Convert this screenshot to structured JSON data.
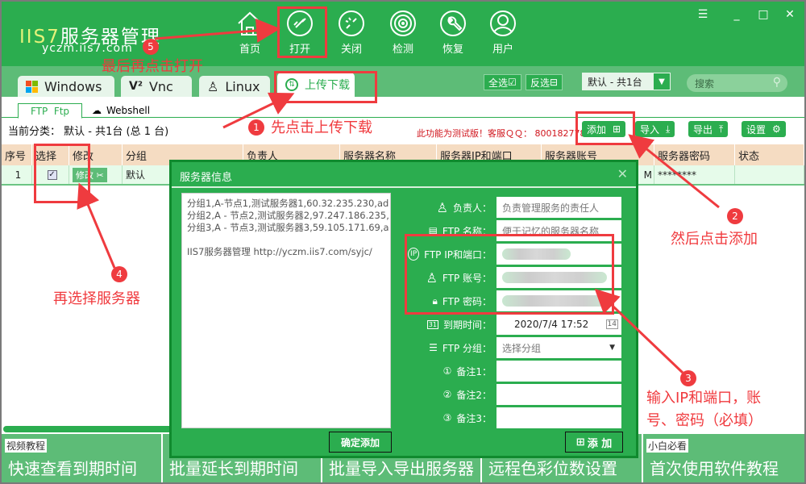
{
  "app": {
    "title_a": "IIS7",
    "title_b": "服务器管理",
    "subtitle": "yczm.iis7.com"
  },
  "nav": [
    {
      "label": "首页",
      "icon": "home-icon"
    },
    {
      "label": "打开",
      "icon": "link-icon"
    },
    {
      "label": "关闭",
      "icon": "unlink-icon"
    },
    {
      "label": "检测",
      "icon": "radar-icon"
    },
    {
      "label": "恢复",
      "icon": "wrench-icon"
    },
    {
      "label": "用户",
      "icon": "user-icon"
    }
  ],
  "window_controls": {
    "menu": "☰",
    "minimize": "_",
    "maximize": "□",
    "close": "✕"
  },
  "tabs": [
    {
      "label": "Windows",
      "icon": "windows-icon"
    },
    {
      "label": "Vnc",
      "icon": "vnc-icon"
    },
    {
      "label": "Linux",
      "icon": "linux-icon"
    },
    {
      "label": "上传下载",
      "icon": "upload-download-icon",
      "active": true
    }
  ],
  "toolbar": {
    "select_all": "全选",
    "invert": "反选",
    "group_select": "默认 - 共1台",
    "search_placeholder": "搜索"
  },
  "subtabs": [
    {
      "label": "FTP  Ftp",
      "active": true
    },
    {
      "label": "Webshell"
    }
  ],
  "category": "当前分类： 默认 - 共1台 (总 1 台)",
  "notice": "此功能为测试版！客服ＱＱ： 800182778",
  "actions": [
    {
      "label": "添加",
      "icon": "plus-box-icon"
    },
    {
      "label": "导入",
      "icon": "import-icon"
    },
    {
      "label": "导出",
      "icon": "export-icon"
    },
    {
      "label": "设置",
      "icon": "gear-icon"
    }
  ],
  "table": {
    "headers": [
      "序号",
      "选择",
      "修改",
      "分组",
      "负责人",
      "服务器名称",
      "服务器IP和端口",
      "服务器账号",
      "服务器密码",
      "状态"
    ],
    "rows": [
      {
        "index": "1",
        "checked": true,
        "edit": "修改",
        "group": "默认",
        "owner": "",
        "name": "",
        "ip": "",
        "account": "M",
        "password": "********",
        "status": ""
      }
    ]
  },
  "dialog": {
    "title": "服务器信息",
    "import_text": "分组1,A-节点1,测试服务器1,60.32.235.230,ad\n分组2,A - 节点2,测试服务器2,97.247.186.235,\n分组3,A - 节点3,测试服务器3,59.105.171.69,a\n\nIIS7服务器管理 http://yczm.iis7.com/syjc/",
    "confirm_label": "确定添加",
    "fields": [
      {
        "label": "负责人：",
        "placeholder": "负责管理服务的责任人",
        "icon": "person-icon"
      },
      {
        "label": "FTP 名称：",
        "placeholder": "便于记忆的服务器名称",
        "icon": "id-card-icon"
      },
      {
        "label": "FTP IP和端口：",
        "value": "",
        "icon": "ip-icon",
        "blurred": true
      },
      {
        "label": "FTP 账号：",
        "value": "",
        "icon": "person-icon",
        "blurred": true
      },
      {
        "label": "FTP 密码：",
        "value": "",
        "icon": "lock-icon",
        "blurred": true
      },
      {
        "label": "到期时间：",
        "value": "2020/7/4 17:52",
        "icon": "calendar-icon"
      },
      {
        "label": "FTP 分组：",
        "value": "选择分组",
        "icon": "list-icon"
      },
      {
        "label": "备注1：",
        "value": "",
        "icon": "circle-1-icon"
      },
      {
        "label": "备注2：",
        "value": "",
        "icon": "circle-2-icon"
      },
      {
        "label": "备注3：",
        "value": "",
        "icon": "circle-3-icon"
      }
    ],
    "add_label": "添 加"
  },
  "tiles": [
    {
      "tag": "视频教程",
      "label": "快速查看到期时间"
    },
    {
      "tag": "",
      "label": "批量延长到期时间"
    },
    {
      "tag": "",
      "label": "批量导入导出服务器"
    },
    {
      "tag": "",
      "label": "远程色彩位数设置"
    },
    {
      "tag": "小白必看",
      "label": "首次使用软件教程"
    }
  ],
  "annotations": [
    {
      "n": "1",
      "text": "先点击上传下载"
    },
    {
      "n": "2",
      "text": "然后点击添加"
    },
    {
      "n": "3",
      "text": "输入IP和端口，账\n号、密码（必填）"
    },
    {
      "n": "4",
      "text": "再选择服务器"
    },
    {
      "n": "5",
      "text": "最后再点击打开"
    }
  ]
}
